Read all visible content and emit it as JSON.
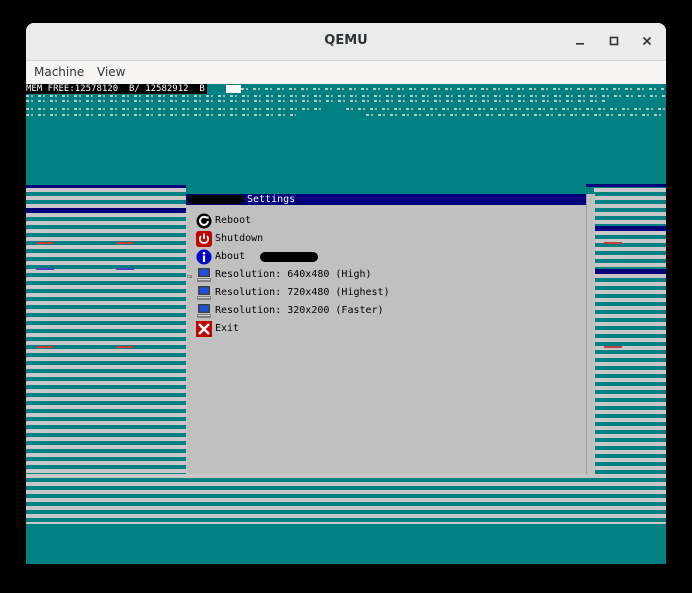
{
  "window": {
    "title": "QEMU"
  },
  "menubar": {
    "items": [
      "Machine",
      "View"
    ]
  },
  "screen": {
    "mem_free": "MEM FREE:12578120  B/ 12582912  B",
    "dialog": {
      "title": "Settings",
      "items": [
        {
          "icon": "reboot-icon",
          "label": "Reboot"
        },
        {
          "icon": "power-icon",
          "label": "Shutdown"
        },
        {
          "icon": "info-icon",
          "label": "About"
        },
        {
          "icon": "monitor-icon",
          "label": "Resolution: 640x480 (High)",
          "selected": true
        },
        {
          "icon": "monitor-icon",
          "label": "Resolution: 720x480 (Highest)"
        },
        {
          "icon": "monitor-icon",
          "label": "Resolution: 320x200 (Faster)"
        },
        {
          "icon": "exit-icon",
          "label": "Exit"
        }
      ]
    }
  },
  "colors": {
    "desktop": "#008080",
    "dialog_bg": "#c0c0c0",
    "dialog_title_bg": "#00007a",
    "reboot": "#000000",
    "power": "#c00000",
    "info": "#0000cc",
    "exit": "#c00000"
  }
}
